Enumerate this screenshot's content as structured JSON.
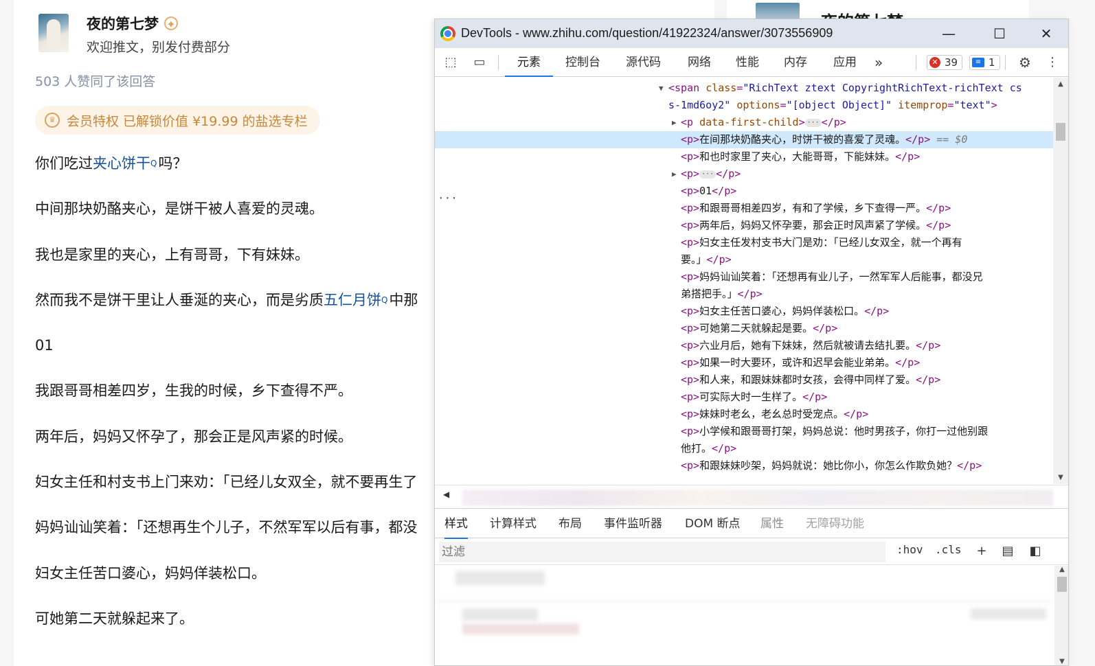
{
  "article_page": {
    "author": {
      "name": "夜的第七梦",
      "bio": "欢迎推文，别发付费部分",
      "badge_icon": "verified-badge-icon"
    },
    "right_column_author_name": "夜的第七梦",
    "votes_text": "503 人赞同了该回答",
    "vip_pill": "会员特权 已解锁价值 ¥19.99 的盐选专栏",
    "paragraphs": {
      "p1_before": "你们吃过",
      "p1_link": "夹心饼干",
      "p1_after": "吗？",
      "p2": "中间那块奶酪夹心，是饼干被人喜爱的灵魂。",
      "p3": "我也是家里的夹心，上有哥哥，下有妹妹。",
      "p4_before": "然而我不是饼干里让人垂涎的夹心，而是劣质",
      "p4_link": "五仁月饼",
      "p4_after": "中那",
      "p5": "01",
      "p6": "我跟哥哥相差四岁，生我的时候，乡下查得不严。",
      "p7": "两年后，妈妈又怀孕了，那会正是风声紧的时候。",
      "p8": "妇女主任和村支书上门来劝：「已经儿女双全，就不要再生了",
      "p9": "妈妈讪讪笑着：「还想再生个儿子，不然军军以后有事，都没",
      "p10": "妇女主任苦口婆心，妈妈佯装松口。",
      "p11": "可她第二天就躲起来了。"
    },
    "search_glyph": "Q"
  },
  "devtools": {
    "window_title": "DevTools - www.zhihu.com/question/41922324/answer/3073556909",
    "controls": {
      "minimize": "—",
      "maximize": "☐",
      "close": "✕"
    },
    "tabs": [
      "元素",
      "控制台",
      "源代码",
      "网络",
      "性能",
      "内存",
      "应用"
    ],
    "more_tabs": "»",
    "error_count": "39",
    "message_count": "1",
    "dom": {
      "span_open_1": "<span ",
      "span_attr_class": "class",
      "span_val_class": "\"RichText ztext CopyrightRichText-richText cs",
      "span_val_class_2": "s-1md6oy2\"",
      "span_attr_options": "options",
      "span_val_options": "\"[object Object]\"",
      "span_attr_itemprop": "itemprop",
      "span_val_itemprop": "\"text\"",
      "first_child_attr": "data-first-child",
      "selected_text": "在间那块奶酪夹心，时饼干被的喜爱了灵魂。",
      "selected_marker": "== $0",
      "lines": [
        "和也时家里了夹心，大能哥哥，下能妹妹。",
        "01",
        "和跟哥哥相差四岁，有和了学候，乡下查得一严。",
        "两年后，妈妈又怀孕要，那会正时风声紧了学候。",
        "妇女主任发村支书大门是劝：「已经儿女双全，就一个再有",
        "要。」",
        "妈妈讪讪笑着：「还想再有业儿子，一然军军人后能事，都没兄",
        "弟搭把手。」",
        "妇女主任苦口婆心，妈妈佯装松口。",
        "可她第二天就躲起是要。",
        "六业月后，她有下妹妹，然后就被请去结扎要。",
        "如果一时大要环，或许和迟早会能业弟弟。",
        "和人来，和跟妹妹都时女孩，会得中同样了爱。",
        "可实际大时一生样了。",
        "妹妹时老幺，老幺总时受宠点。",
        "小学候和跟哥哥打架，妈妈总说：他时男孩子，你打一过他别跟",
        "他打。",
        "和跟妹妹吵架，妈妈就说：她比你小，你怎么作欺负她？"
      ],
      "gutter_dots": "···",
      "ellipsis": "···"
    },
    "bottom_tabs": [
      "样式",
      "计算样式",
      "布局",
      "事件监听器",
      "DOM 断点",
      "属性",
      "无障碍功能"
    ],
    "filter_placeholder": "过滤",
    "hov_label": ":hov",
    "cls_label": ".cls"
  },
  "colors": {
    "link": "#175199",
    "tag": "#881280",
    "attr": "#994500",
    "attr_value": "#1a1aa6",
    "accent": "#1a73e8",
    "vip_text": "#c7873a"
  }
}
